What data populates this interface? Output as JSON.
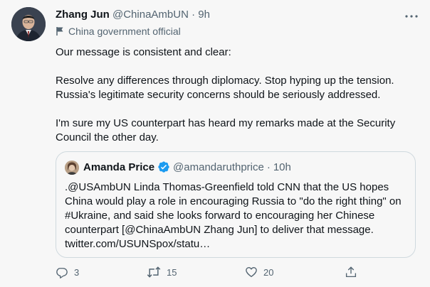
{
  "author": {
    "name": "Zhang Jun",
    "handle": "@ChinaAmbUN",
    "separator": "·",
    "time": "9h",
    "label": "China government official",
    "label_icon": "flag-icon"
  },
  "tweet": {
    "paragraphs": [
      "Our message is consistent and clear:",
      "Resolve any differences through diplomacy. Stop hyping up the tension. Russia's legitimate security concerns should be seriously addressed.",
      "I'm sure my US counterpart has heard my remarks made at the Security Council the other day."
    ]
  },
  "quote": {
    "name": "Amanda Price",
    "verified": true,
    "handle": "@amandaruthprice",
    "separator": "·",
    "time": "10h",
    "text": ".@USAmbUN Linda Thomas-Greenfield told CNN that the US hopes China would play a role in encouraging Russia to \"do the right thing\" on #Ukraine, and said she looks forward to encouraging her Chinese counterpart [@ChinaAmbUN Zhang Jun] to deliver that message. twitter.com/USUNSpox/statu…"
  },
  "actions": {
    "replies": "3",
    "retweets": "15",
    "likes": "20"
  },
  "colors": {
    "background": "#f7f7f7",
    "text": "#0f1419",
    "muted": "#536471",
    "verified": "#1d9bf0",
    "border": "#cfd9de"
  }
}
